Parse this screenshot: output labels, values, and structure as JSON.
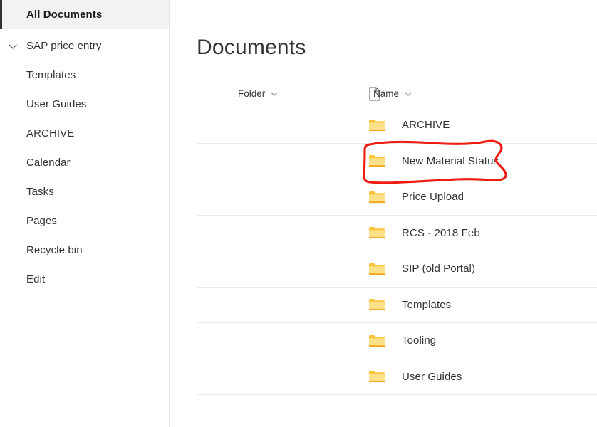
{
  "sidebar": {
    "items": [
      {
        "label": "All Documents",
        "selected": true,
        "chevron": null
      },
      {
        "label": "SAP price entry",
        "selected": false,
        "chevron": "chevron-down-icon"
      },
      {
        "label": "Templates",
        "selected": false,
        "chevron": null
      },
      {
        "label": "User Guides",
        "selected": false,
        "chevron": null
      },
      {
        "label": "ARCHIVE",
        "selected": false,
        "chevron": null
      },
      {
        "label": "Calendar",
        "selected": false,
        "chevron": null
      },
      {
        "label": "Tasks",
        "selected": false,
        "chevron": null
      },
      {
        "label": "Pages",
        "selected": false,
        "chevron": null
      },
      {
        "label": "Recycle bin",
        "selected": false,
        "chevron": null
      },
      {
        "label": "Edit",
        "selected": false,
        "chevron": null
      }
    ]
  },
  "main": {
    "title": "Documents",
    "columns": [
      {
        "label": "Folder",
        "sort_icon": "chevron-down-icon"
      },
      {
        "label": "Name",
        "sort_icon": "chevron-down-icon",
        "type_icon": "document-icon"
      }
    ],
    "rows": [
      {
        "name": "ARCHIVE",
        "icon": "folder-icon"
      },
      {
        "name": "New Material Status",
        "icon": "folder-icon",
        "annotated": true
      },
      {
        "name": "Price Upload",
        "icon": "folder-icon"
      },
      {
        "name": "RCS - 2018 Feb",
        "icon": "folder-icon"
      },
      {
        "name": "SIP (old Portal)",
        "icon": "folder-icon"
      },
      {
        "name": "Templates",
        "icon": "folder-icon"
      },
      {
        "name": "Tooling",
        "icon": "folder-icon"
      },
      {
        "name": "User Guides",
        "icon": "folder-icon"
      }
    ]
  },
  "annotation": {
    "shape": "hand-drawn-circle",
    "target": "New Material Status",
    "color": "#ee1b11"
  },
  "colors": {
    "folder_body": "#fde08a",
    "folder_tab": "#fcc63a",
    "folder_edge": "#f0a81e",
    "selected_bg": "#f3f2f1",
    "selected_bar": "#323130",
    "row_divider": "#ebebeb",
    "text": "#333333",
    "annotation_red": "#ee1b11"
  }
}
